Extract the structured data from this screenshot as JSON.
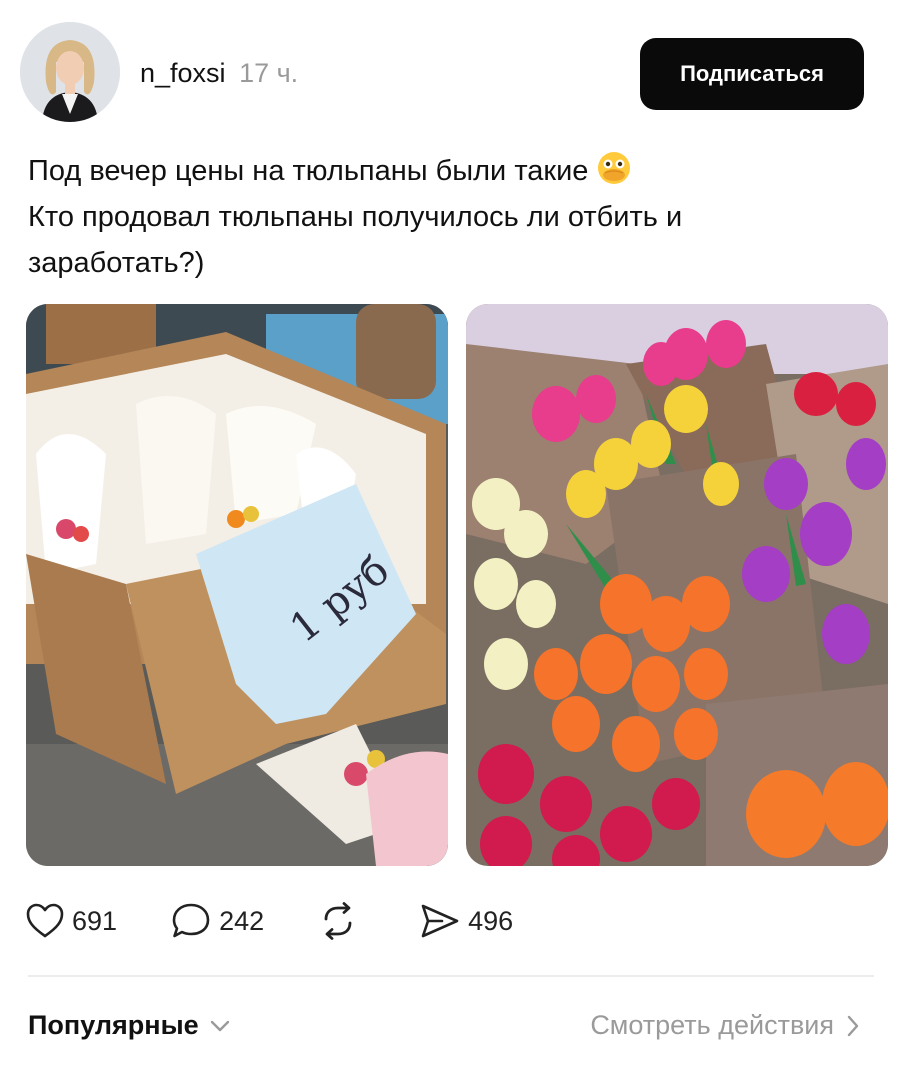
{
  "post": {
    "author": {
      "username": "n_foxsi",
      "time_ago": "17 ч."
    },
    "follow_button": "Подписаться",
    "text_lines": [
      "Под вечер цены на тюльпаны были такие",
      "Кто продовал тюльпаны получилось ли отбить и",
      "заработать?)"
    ],
    "emoji_icon": "face-with-open-eyes-and-hand-over-mouth-icon",
    "photos": [
      {
        "name": "tulips-in-box-photo",
        "sign_text": "1 руб"
      },
      {
        "name": "tulip-bouquets-photo"
      }
    ],
    "stats": {
      "likes": "691",
      "comments": "242",
      "shares": "496"
    }
  },
  "footer": {
    "sort_label": "Популярные",
    "view_actions_label": "Смотреть действия"
  }
}
